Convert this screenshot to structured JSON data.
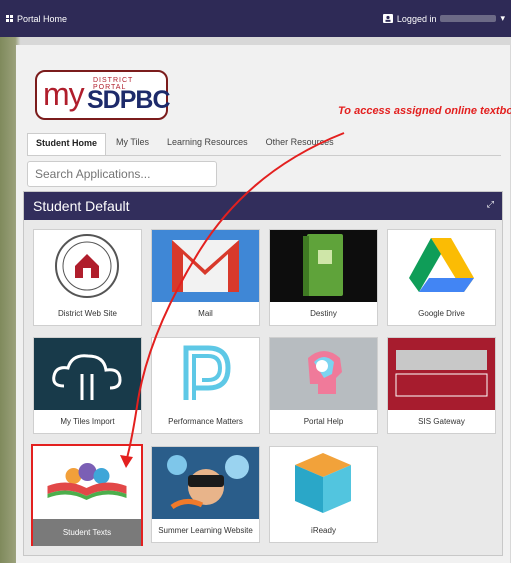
{
  "topbar": {
    "home_label": "Portal Home",
    "user_label": "Logged in"
  },
  "logo": {
    "my": "my",
    "district_portal": "DISTRICT PORTAL",
    "sdpbc": "SDPBC"
  },
  "annotation": "To access assigned online textbooks",
  "tabs": [
    {
      "label": "Student Home",
      "active": true
    },
    {
      "label": "My Tiles"
    },
    {
      "label": "Learning Resources"
    },
    {
      "label": "Other Resources"
    }
  ],
  "search": {
    "placeholder": "Search Applications..."
  },
  "widget": {
    "title": "Student Default"
  },
  "tiles": [
    {
      "label": "District Web Site",
      "icon": "school-district-seal-icon"
    },
    {
      "label": "Mail",
      "icon": "gmail-icon"
    },
    {
      "label": "Destiny",
      "icon": "destiny-book-icon"
    },
    {
      "label": "Google Drive",
      "icon": "google-drive-icon"
    },
    {
      "label": "My Tiles Import",
      "icon": "cloud-upload-icon"
    },
    {
      "label": "Performance Matters",
      "icon": "performance-matters-icon"
    },
    {
      "label": "Portal Help",
      "icon": "portal-help-icon"
    },
    {
      "label": "SIS Gateway",
      "icon": "sis-gateway-icon"
    },
    {
      "label": "Student Texts",
      "icon": "open-book-icon",
      "selected": true
    },
    {
      "label": "Summer Learning Website",
      "icon": "vr-learning-icon"
    },
    {
      "label": "iReady",
      "icon": "iready-cube-icon"
    }
  ],
  "colors": {
    "topbar": "#2e2a56",
    "accent_red": "#e3201f",
    "brand_red": "#b01e2c",
    "brand_blue": "#1d2a6a"
  }
}
